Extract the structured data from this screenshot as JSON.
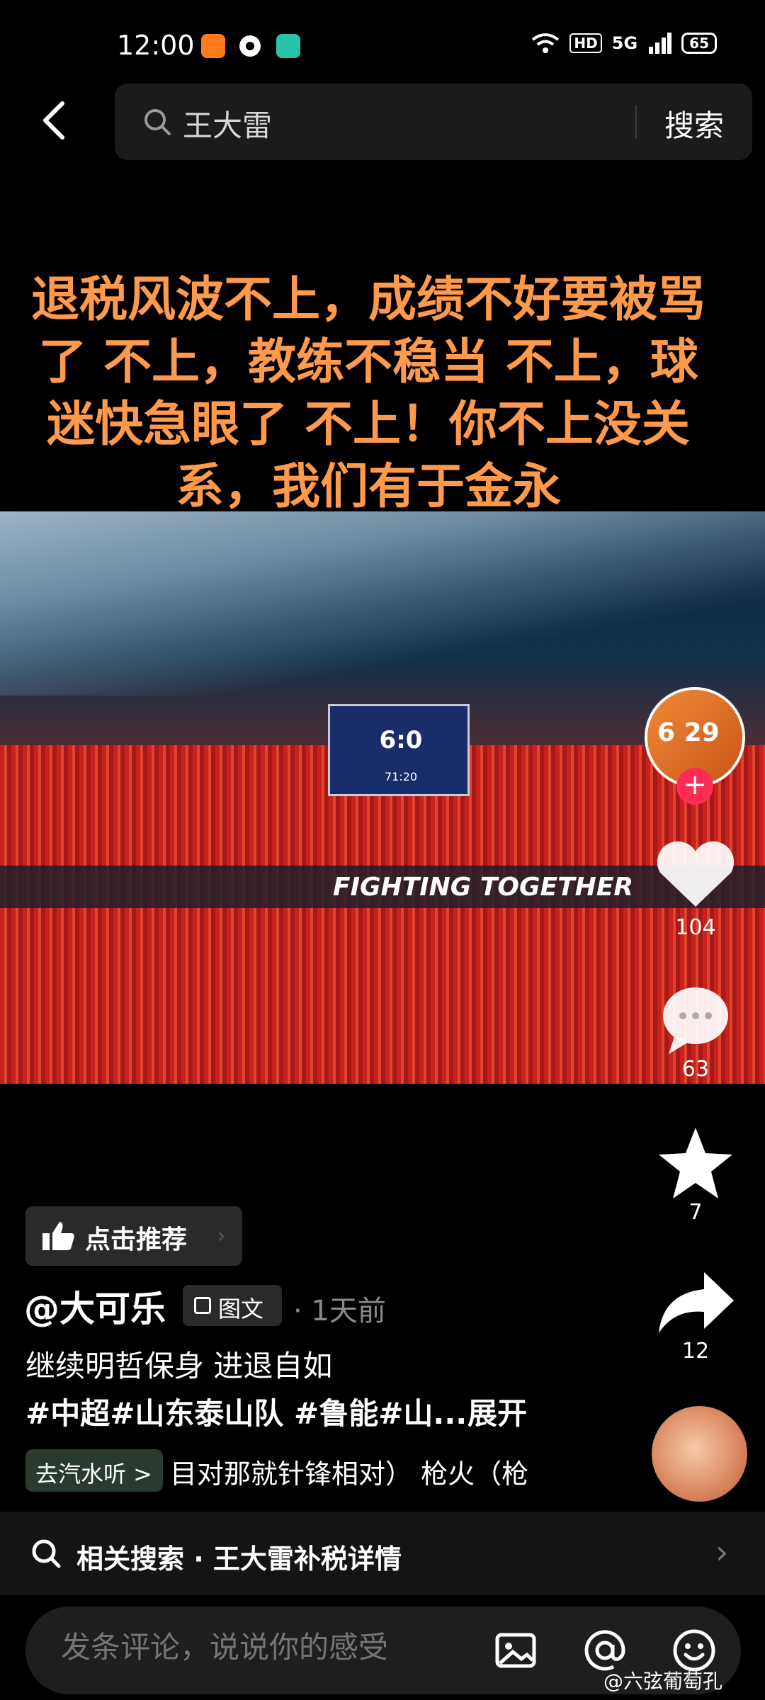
{
  "status_bar": {
    "time": "12:00",
    "icons": [
      "hd-badge",
      "5g-signal",
      "wifi-icon"
    ],
    "hd": "HD",
    "network": "5G",
    "battery": "65"
  },
  "header": {
    "back_icon": "back-arrow-icon",
    "search_value": "王大雷",
    "search_button": "搜索"
  },
  "post": {
    "caption": "退税风波不上，成绩不好要被骂了 不上，教练不稳当 不上，球迷快急眼了 不上！你不上没关系，我们有于金永",
    "scoreboard_score": "6:0",
    "scoreboard_time": "71:20",
    "banner_text": "FIGHTING TOGETHER",
    "likes": "104",
    "comments": "63",
    "favorites": "7",
    "shares": "12",
    "recommend_label": "点击推荐",
    "author": "@大可乐",
    "type_label": "图文",
    "time_ago": "· 1天前",
    "description": "继续明哲保身 进退自如",
    "tags": "#中超#山东泰山队 #鲁能#山...",
    "expand": "展开",
    "music_pill": "去汽水听 >",
    "music_text": "目对那就针锋相对）   枪火（枪"
  },
  "related": {
    "label": "相关搜索 · 王大雷补税详情"
  },
  "comment_bar": {
    "placeholder": "发条评论，说说你的感受"
  },
  "watermark": "@六弦葡萄孔"
}
